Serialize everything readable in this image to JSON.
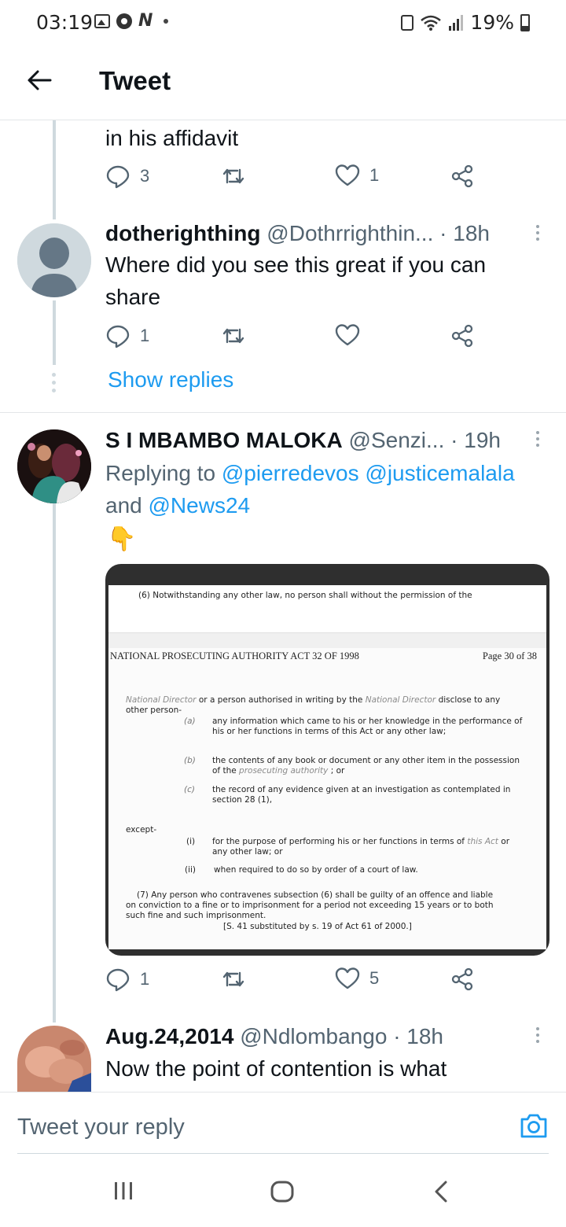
{
  "status_bar": {
    "time": "03:19",
    "battery": "19%"
  },
  "header": {
    "title": "Tweet"
  },
  "tweet_prev": {
    "text_tail": "in his affidavit",
    "reply_count": "3",
    "like_count": "1"
  },
  "tweet_1": {
    "name": "dotherighthing",
    "handle": "@Dothrrighthin...",
    "time": "· 18h",
    "text_line1": "Where did you see this great if you can",
    "text_line2": "share",
    "reply_count": "1",
    "like_count": "",
    "show_replies": "Show replies"
  },
  "tweet_2": {
    "name": "S I MBAMBO MALOKA",
    "handle": "@Senzi...",
    "time": "· 19h",
    "replying_prefix": "Replying to",
    "mention_1": "@pierredevos",
    "mention_2": "@justicemalala",
    "and_text": "and",
    "mention_3": "@News24",
    "emoji": "👇",
    "reply_count": "1",
    "like_count": "5",
    "document": {
      "top_line": "(6) Notwithstanding any other law, no person shall without the permission of the",
      "act_title": "NATIONAL PROSECUTING AUTHORITY ACT 32 OF 1998",
      "page_label": "Page 30 of 38",
      "intro_national_director_1": "National Director",
      "intro_mid": "or a person authorised in writing by the",
      "intro_national_director_2": "National Director",
      "intro_end": "disclose to any",
      "intro_line2": "other person-",
      "items": [
        {
          "mark": "(a)",
          "text": "any information which came to his or her knowledge in the performance of his or her functions in terms of this Act or any other law;"
        },
        {
          "mark": "(b)",
          "text_before": "the contents of any book or document or any other item in the possession of the",
          "text_italic": "prosecuting authority",
          "text_after": "; or"
        },
        {
          "mark": "(c)",
          "text": "the record of any evidence given at an investigation as contemplated in section 28 (1),"
        }
      ],
      "except_label": "except-",
      "except_items": [
        {
          "mark": "(i)",
          "text_before": "for the purpose of performing his or her functions in terms of",
          "text_italic": "this Act",
          "text_after": "or any other law; or"
        },
        {
          "mark": "(ii)",
          "text": "when required to do so by order of a court of law."
        }
      ],
      "para7_line1": "(7) Any person who contravenes subsection (6) shall be guilty of an offence and liable",
      "para7_line2": "on conviction to a fine or to imprisonment for a period not exceeding 15 years or to both",
      "para7_line3": "such fine and such imprisonment.",
      "substituted": "[S. 41 substituted by s. 19 of Act 61 of 2000.]"
    }
  },
  "tweet_3": {
    "name": "Aug.24,2014",
    "handle": "@Ndlombango",
    "time": "· 18h",
    "text_line1": "Now the point of contention is what"
  },
  "reply_bar": {
    "placeholder": "Tweet your reply"
  },
  "icons": {
    "accent": "#1d9bf0",
    "icon_grey": "#536471"
  }
}
